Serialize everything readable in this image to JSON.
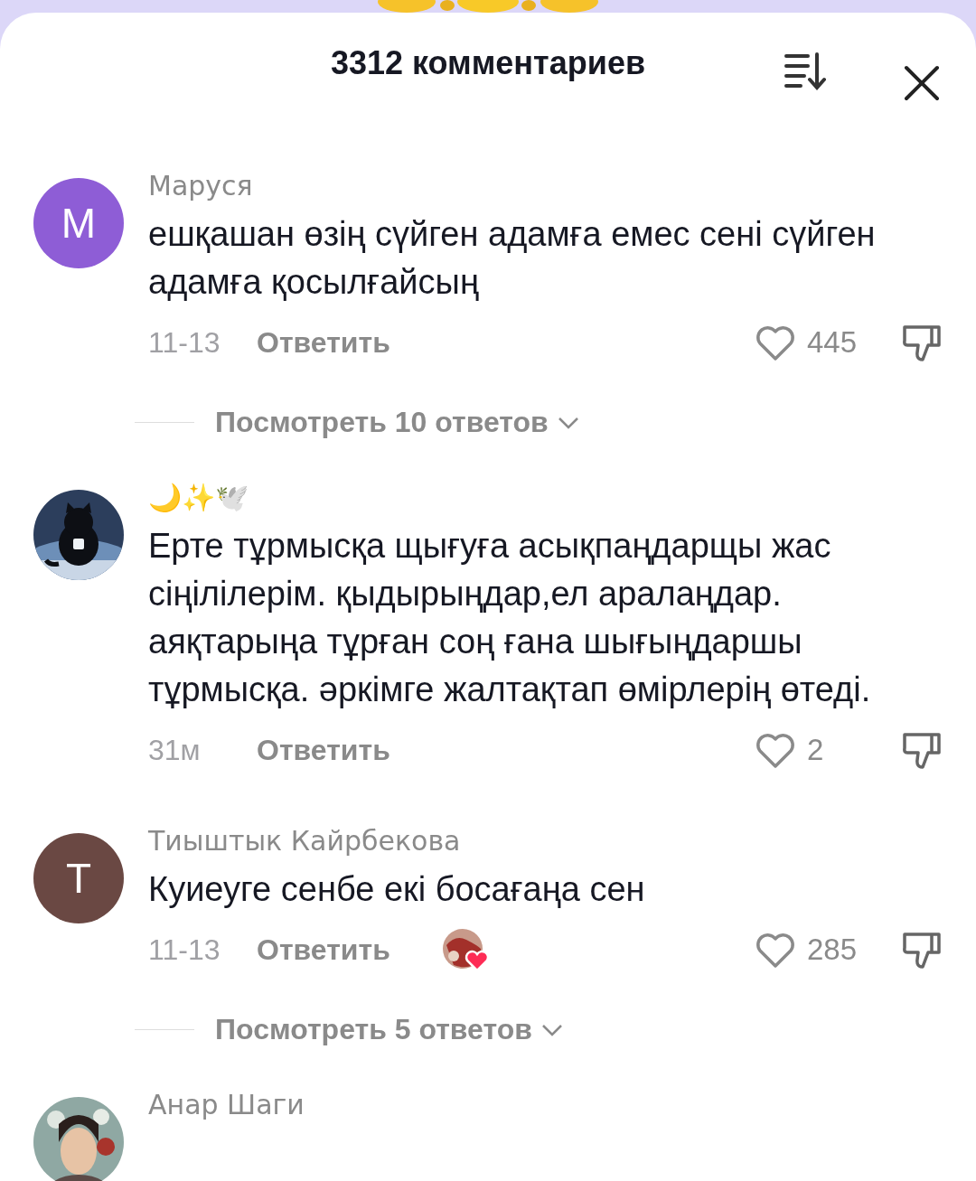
{
  "header": {
    "title": "3312 комментариев"
  },
  "comments": [
    {
      "avatar": {
        "kind": "letter",
        "letter": "M",
        "color": "#8e5dd6"
      },
      "name": "Маруся",
      "text": "ешқашан өзің сүйген адамға емес сені сүйген адамға қосылғайсың",
      "time": "11-13",
      "reply": "Ответить",
      "liked_by_creator": false,
      "likes": "445",
      "replies": "Посмотреть 10 ответов"
    },
    {
      "name": "🌙✨🕊️",
      "text": "Ерте тұрмысқа щығуға асықпаңдарщы жас сіңілілерім. қыдырыңдар,ел аралаңдар. аяқтарыңа тұрған соң ғана шығыңдаршы тұрмысқа. әркімге жалтақтап өмірлерің өтеді.",
      "time": "31м",
      "reply": "Ответить",
      "liked_by_creator": false,
      "likes": "2"
    },
    {
      "avatar": {
        "kind": "letter",
        "letter": "Т",
        "color": "#6a4843"
      },
      "name": "Тиыштык Кайрбекова",
      "text": "Куиеуге сенбе екі босағаңа сен",
      "time": "11-13",
      "reply": "Ответить",
      "liked_by_creator": true,
      "likes": "285",
      "replies": "Посмотреть 5 ответов"
    },
    {
      "name": "Анар Шаги"
    }
  ]
}
